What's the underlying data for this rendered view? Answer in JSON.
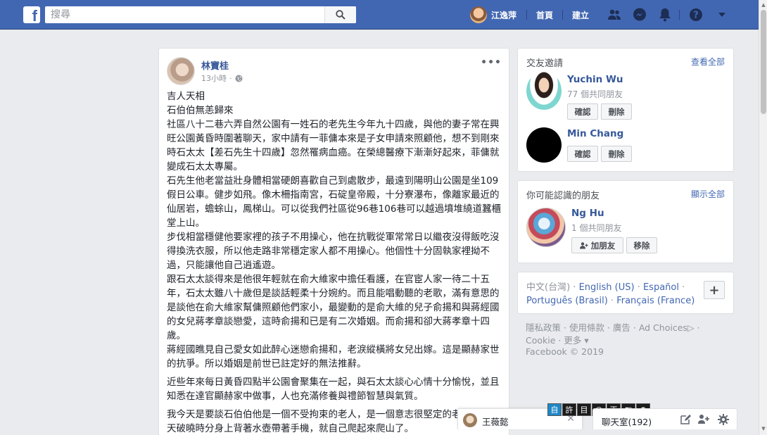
{
  "topbar": {
    "logo": "f",
    "search_placeholder": "搜尋",
    "user_name": "江逸萍",
    "home_label": "首頁",
    "create_label": "建立",
    "icons": [
      "friends-icon",
      "messenger-icon",
      "notifications-icon",
      "help-icon",
      "dropdown-caret-icon"
    ]
  },
  "post": {
    "author": "林寶桂",
    "time": "13小時",
    "privacy_icon": "globe-icon",
    "paragraphs": [
      "吉人天相",
      "石伯伯無恙歸來",
      "社區八十二巷六弄自然公園有一姓石的老先生今年九十四歲，與他的妻子常在興旺公園黃昏時圍著聊天，家中請有一菲傭本來是子女申請來照顧他，想不到剛來時石太太【差石先生十四歲】忽然罹病血癌。在榮總醫療下漸漸好起來，菲傭就變成石太太專屬。",
      "石先生他老當益壯身體相當硬朗喜歡自己到處散步，最遠到陽明山公園是坐109假日公車。健步如飛。像木柵指南宮，石碇皇帝殿，十分寮瀑布，像離家最近的仙居岩，蟾蜍山，鳳梯山。可以從我們社區從96巷106巷可以越過墳堆繞道蠶櫃堂上山。",
      "步伐相當穩健他要家裡的孩子不用操心，他在抗戰從軍常常日以繼夜沒得飯吃沒得換洗衣服，所以他走路非常穩定家人都不用操心。他個性十分固執家裡拗不過，只能讓他自己逍遙遊。",
      "跟石太太談得來是他很年輕就在俞大維家中擔任看護，在官宦人家一待二十五年，石太太雖八十歲但是談話輕柔十分婉約。而且能唱動聽的老歌，滿有意思的是談他在俞大維家幫傭照顧他們家小，最變動的是俞大維的兒子俞揚和與蔣經國的女兒蔣孝章談戀愛，這時俞揚和已是有二次婚姻。而俞揚和卻大蔣孝章十四歲。",
      "蔣經國瞧見自己愛女如此醉心迷戀俞揚和，老淚縱橫將女兒出嫁。這是顯赫家世的抗爭。所以婚姻是前世已註定好的無法推辭。",
      "近些年來每日黃昏四點半公園會聚集在一起，與石太太談心心情十分愉悅，並且知悉在達官顯赫家中做事，人也充滿修養與禮節智慧與氣質。",
      "我今天是要談石伯伯他是一個不受拘束的老人，是一個意志很堅定的老人性格，天破曉時分身上背著水壺帶著手機，就自己爬起來爬山了。"
    ]
  },
  "friend_requests": {
    "title": "交友邀請",
    "see_all": "查看全部",
    "items": [
      {
        "name": "Yuchin Wu",
        "mutual": "77 個共同朋友",
        "confirm": "確認",
        "delete": "刪除"
      },
      {
        "name": "Min Chang",
        "mutual": "",
        "confirm": "確認",
        "delete": "刪除"
      }
    ]
  },
  "pymk": {
    "title": "你可能認識的朋友",
    "see_all": "顯示全部",
    "items": [
      {
        "name": "Ng Hu",
        "mutual": "1 個共同朋友",
        "add": "加朋友",
        "remove": "移除"
      }
    ]
  },
  "languages": {
    "items": [
      "中文(台灣)",
      "English (US)",
      "Español",
      "Português (Brasil)",
      "Français (France)"
    ],
    "add_icon": "plus-icon"
  },
  "footer": {
    "links": [
      "隱私政策",
      "使用條款",
      "廣告",
      "Ad Choices",
      "Cookie",
      "更多"
    ],
    "copyright": "Facebook © 2019"
  },
  "chat": {
    "tab_name": "王薇懿",
    "bar_label": "聊天室(192)"
  },
  "ime": [
    "自",
    "許",
    "目",
    "@",
    "正",
    "◧",
    "⚙"
  ],
  "colors": {
    "brand": "#4267b2",
    "link": "#365899",
    "background": "#e9ebee"
  }
}
